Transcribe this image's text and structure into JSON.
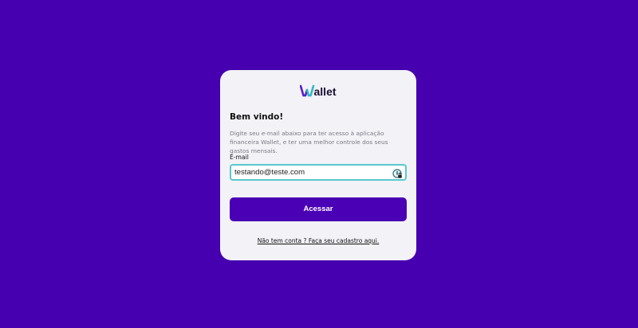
{
  "app": {
    "logo_text": "Wallet",
    "colors": {
      "background": "#4600b0",
      "card": "#f3f2f7",
      "primary": "#4a00b4",
      "input_border": "#5ac8cf"
    }
  },
  "login": {
    "title": "Bem vindo!",
    "description": "Digite seu e-mail abaixo para ter acesso à aplicação financeira Wallet, e ter uma melhor controle dos seus gastos mensais.",
    "email_label": "E-mail",
    "email_value": "testando@teste.com",
    "password_manager_icon": "password-manager-icon",
    "submit_label": "Acessar",
    "signup_link": "Não tem conta ? Faça seu cadastro aqui."
  }
}
